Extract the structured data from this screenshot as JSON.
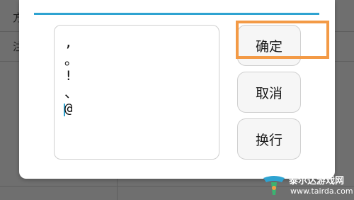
{
  "background": {
    "row1_label": "方",
    "row2_label": "注"
  },
  "dialog": {
    "text_lines": [
      ",",
      "。",
      "!",
      "、",
      "@"
    ],
    "buttons": {
      "confirm": "确定",
      "cancel": "取消",
      "newline": "换行"
    }
  },
  "watermark": {
    "name": "泰尔达游戏网",
    "url": "www.tairda.com"
  },
  "colors": {
    "accent": "#2ea3d1",
    "highlight": "#f39a46",
    "overlay": "#6f6f6f"
  }
}
